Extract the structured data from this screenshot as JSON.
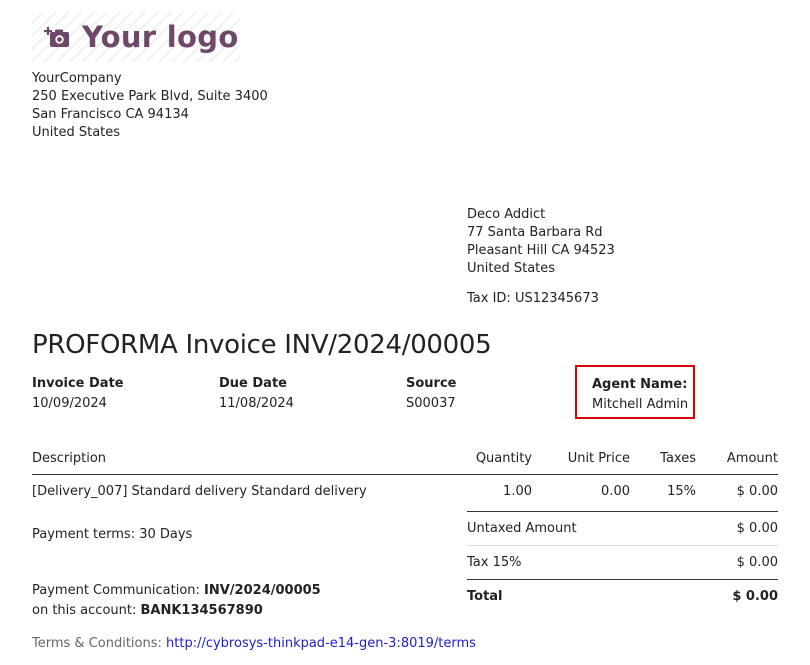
{
  "logo": {
    "text": "Your logo",
    "icon": "camera-plus-icon",
    "color": "#6e4869"
  },
  "company": {
    "name": "YourCompany",
    "street": "250 Executive Park Blvd, Suite 3400",
    "city": "San Francisco CA 94134",
    "country": "United States"
  },
  "customer": {
    "name": "Deco Addict",
    "street": "77 Santa Barbara Rd",
    "city": "Pleasant Hill CA 94523",
    "country": "United States",
    "tax_id": "Tax ID: US12345673"
  },
  "invoice": {
    "title": "PROFORMA Invoice INV/2024/00005",
    "date_label": "Invoice Date",
    "date_value": "10/09/2024",
    "due_label": "Due Date",
    "due_value": "11/08/2024",
    "source_label": "Source",
    "source_value": "S00037",
    "agent_label": "Agent Name:",
    "agent_value": "Mitchell Admin",
    "highlight_color": "#e00000"
  },
  "lines": {
    "headers": {
      "description": "Description",
      "quantity": "Quantity",
      "unit_price": "Unit Price",
      "taxes": "Taxes",
      "amount": "Amount"
    },
    "rows": [
      {
        "description": "[Delivery_007] Standard delivery Standard delivery",
        "quantity": "1.00",
        "unit_price": "0.00",
        "taxes": "15%",
        "amount": "$ 0.00"
      }
    ]
  },
  "payment_terms": "Payment terms: 30 Days",
  "totals": {
    "untaxed_label": "Untaxed Amount",
    "untaxed_value": "$ 0.00",
    "tax_label": "Tax 15%",
    "tax_value": "$ 0.00",
    "total_label": "Total",
    "total_value": "$ 0.00"
  },
  "payment": {
    "comm_label": "Payment Communication: ",
    "comm_value": "INV/2024/00005",
    "account_label": "on this account: ",
    "account_value": "BANK134567890"
  },
  "terms": {
    "label": "Terms & Conditions: ",
    "link": "http://cybrosys-thinkpad-e14-gen-3:8019/terms"
  }
}
